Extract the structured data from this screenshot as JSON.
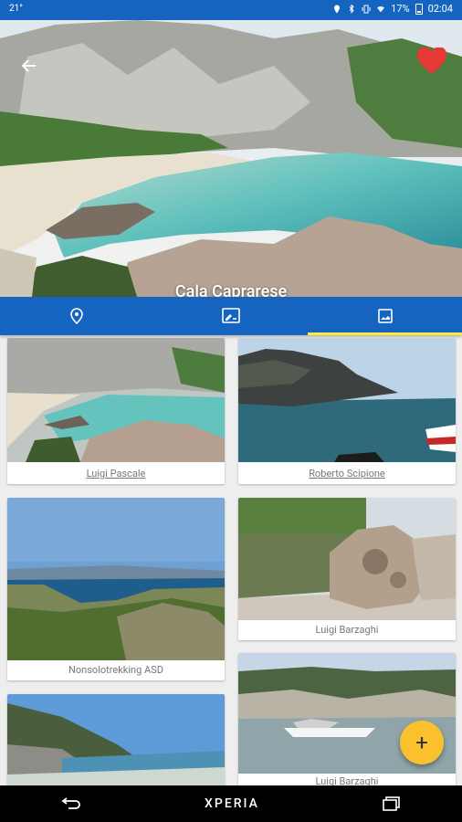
{
  "status_bar": {
    "left_text": "21°",
    "battery": "17%",
    "time": "02:04"
  },
  "hero": {
    "title": "Cala Caprarese"
  },
  "tabs": [
    {
      "name": "location",
      "icon": "location-pin-icon",
      "active": false
    },
    {
      "name": "description",
      "icon": "edit-note-icon",
      "active": false
    },
    {
      "name": "photos",
      "icon": "image-icon",
      "active": true
    }
  ],
  "gallery": {
    "items": [
      {
        "caption": "Luigi Pascale"
      },
      {
        "caption": "Roberto Scipione"
      },
      {
        "caption": "Nonsolotrekking ASD"
      },
      {
        "caption": "Luigi Barzaghi"
      },
      {
        "caption": "Luigi Barzaghi"
      },
      {
        "caption": ""
      }
    ]
  },
  "fab": {
    "label": "+"
  },
  "nav_bar": {
    "brand": "XPERIA"
  },
  "colors": {
    "primary": "#1565c0",
    "accent": "#fbc02d",
    "tab_indicator": "#ffeb3b",
    "favorite": "#e53935"
  }
}
